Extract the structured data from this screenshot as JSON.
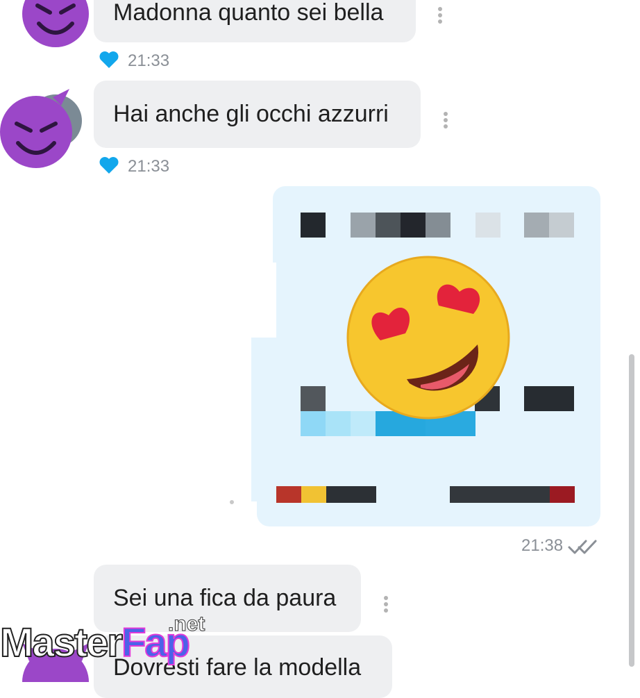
{
  "messages": [
    {
      "id": "m1",
      "direction": "incoming",
      "text": "Madonna quanto sei bella",
      "time": "21:33",
      "reaction": "heart-icon"
    },
    {
      "id": "m2",
      "direction": "incoming",
      "text": "Hai anche gli occhi azzurri",
      "time": "21:33",
      "reaction": "heart-icon"
    },
    {
      "id": "m3",
      "direction": "outgoing",
      "content": "censored-image-message",
      "time": "21:38",
      "status": "read"
    },
    {
      "id": "m4",
      "direction": "incoming",
      "text": "Sei una fica da paura"
    },
    {
      "id": "m5",
      "direction": "incoming",
      "text": "Dovresti fare la modella"
    }
  ],
  "overlay": {
    "emoji": "heart-eyes-emoji",
    "avatar_emoji": "smiling-devil-emoji"
  },
  "watermark": {
    "main": "MasterFap",
    "master": "Master",
    "fap": "Fap",
    "suffix": ".net"
  },
  "colors": {
    "incoming_bubble": "#eeeff1",
    "outgoing_bubble": "#e5f4fd",
    "heart": "#12a7ec",
    "devil_purple": "#9b47c8",
    "emoji_yellow": "#f7c62e",
    "emoji_heart": "#e3233b",
    "watermark_fap": "#4b63e8"
  }
}
